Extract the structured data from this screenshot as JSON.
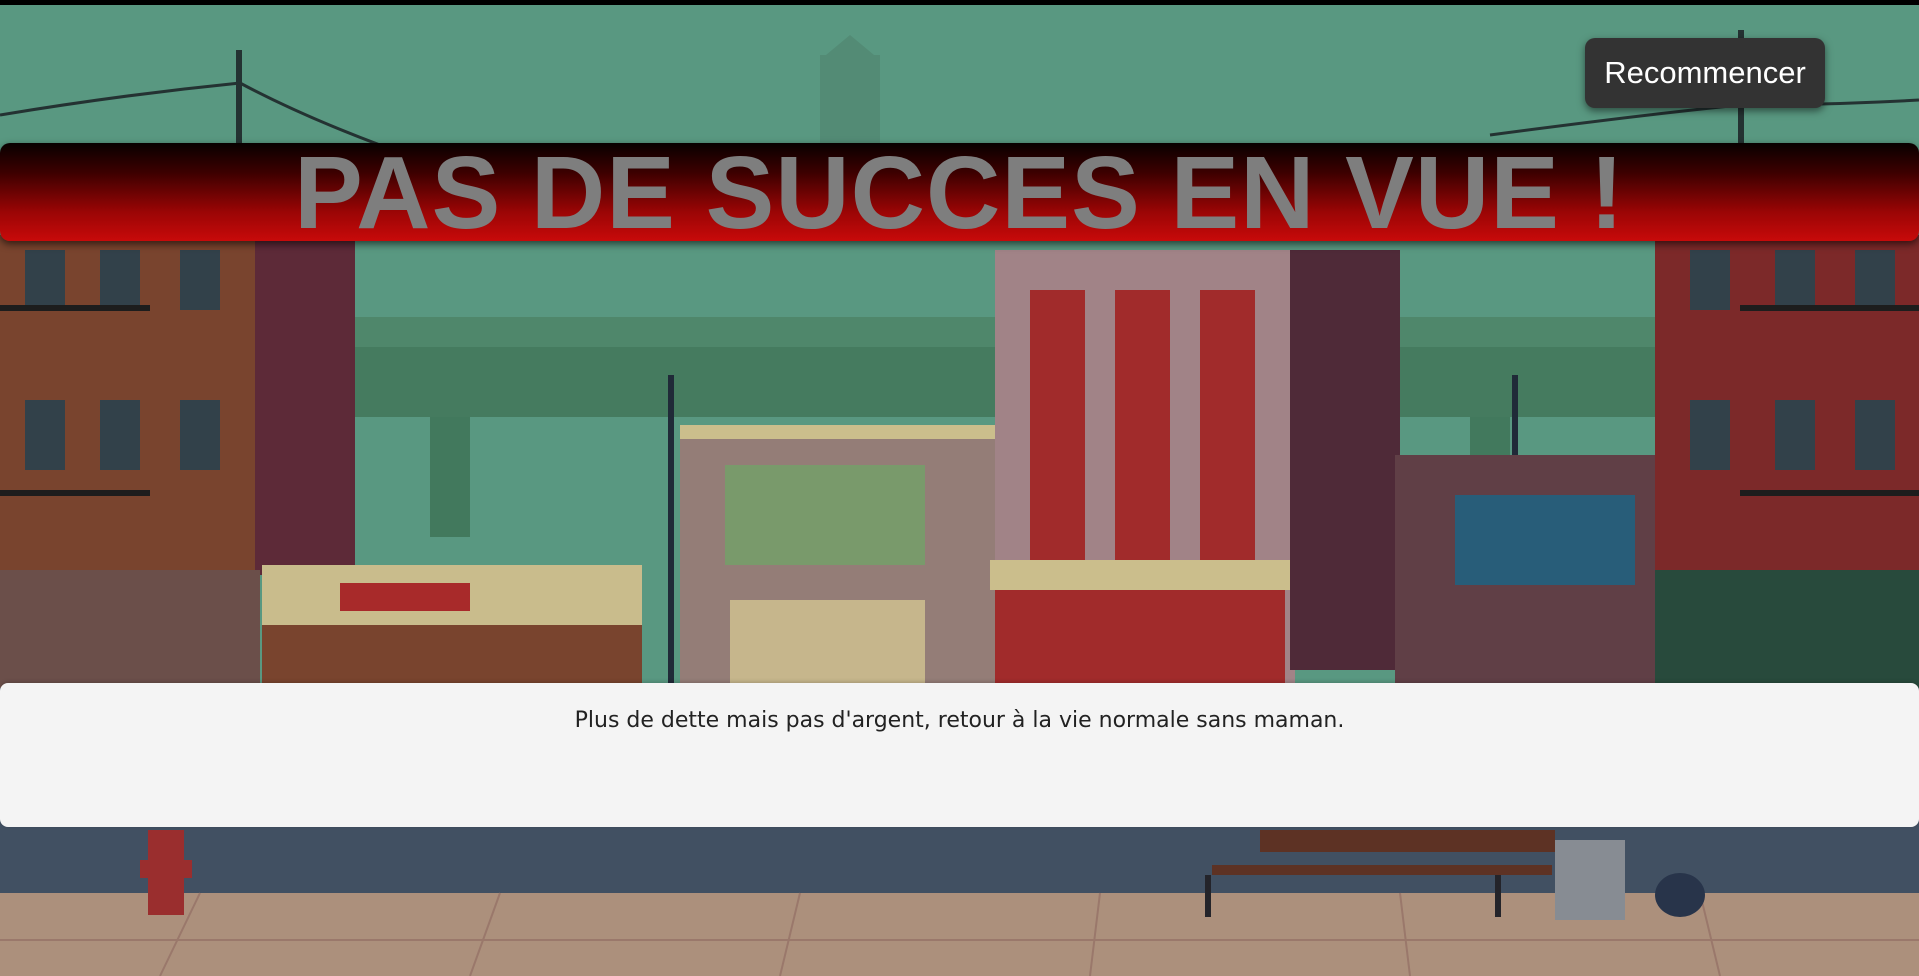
{
  "restart_button": {
    "label": "Recommencer"
  },
  "banner": {
    "title": "PAS DE SUCCES EN VUE !"
  },
  "message": {
    "text": "Plus de dette mais pas d'argent, retour à la vie normale sans maman."
  },
  "colors": {
    "sky": "#66ad93",
    "banner_red": "#c80a0a",
    "title_gray": "#7e7e7e",
    "button_bg": "#333333",
    "message_bg": "#f4f4f4"
  }
}
